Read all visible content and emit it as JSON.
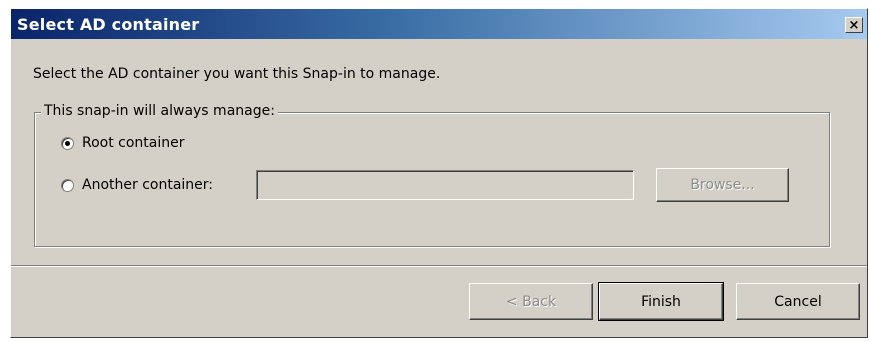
{
  "window": {
    "title": "Select AD container"
  },
  "titlebar": {
    "close_label": "×"
  },
  "instruction": "Select the AD container you want this Snap-in to manage.",
  "group": {
    "legend": "This snap-in will always manage:",
    "options": [
      {
        "label": "Root container",
        "checked": true
      },
      {
        "label": "Another container:",
        "checked": false
      }
    ],
    "container_path_value": "",
    "browse_label": "Browse...",
    "browse_enabled": false
  },
  "buttons": {
    "back_label": "< Back",
    "back_enabled": false,
    "finish_label": "Finish",
    "cancel_label": "Cancel"
  },
  "colors": {
    "dialog_bg": "#d4d0c8",
    "title_gradient_start": "#0a246a",
    "title_gradient_end": "#a6caf0",
    "title_text": "#ffffff",
    "disabled_text": "#8c8c8c"
  }
}
